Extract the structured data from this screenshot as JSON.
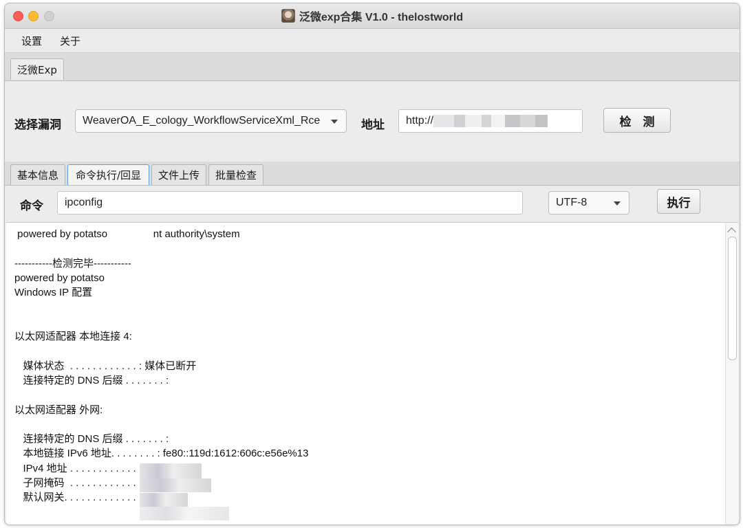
{
  "window": {
    "title": "泛微exp合集 V1.0 - thelostworld"
  },
  "menu": {
    "items": [
      "设置",
      "关于"
    ]
  },
  "outer_tab": {
    "label": "泛微Exp"
  },
  "vuln_panel": {
    "select_label": "选择漏洞",
    "selected_vuln": "WeaverOA_E_cology_WorkflowServiceXml_Rce",
    "address_label": "地址",
    "address_value": "http://",
    "check_button": "检　测"
  },
  "inner_tabs": {
    "items": [
      "基本信息",
      "命令执行/回显",
      "文件上传",
      "批量检查"
    ],
    "active_index": 1
  },
  "command_panel": {
    "command_label": "命令",
    "command_value": "ipconfig",
    "encoding_value": "UTF-8",
    "execute_button": "执行"
  },
  "output": {
    "lines": [
      " powered by potatso                nt authority\\system",
      "",
      "-----------检测完毕-----------",
      "powered by potatso",
      "Windows IP 配置",
      "",
      "",
      "以太网适配器 本地连接 4:",
      "",
      "   媒体状态  . . . . . . . . . . . . : 媒体已断开",
      "   连接特定的 DNS 后缀 . . . . . . . :",
      "",
      "以太网适配器 外网:",
      "",
      "   连接特定的 DNS 后缀 . . . . . . . :",
      "   本地链接 IPv6 地址. . . . . . . . : fe80::119d:1612:606c:e56e%13",
      "   IPv4 地址 . . . . . . . . . . . . :",
      "   子网掩码  . . . . . . . . . . . . :",
      "   默认网关. . . . . . . . . . . . . :"
    ]
  },
  "colors": {
    "active_tab_border": "#5aa0e6",
    "close": "#fd5f57",
    "minimize": "#febb2e",
    "maximize": "#d0d0d0"
  }
}
